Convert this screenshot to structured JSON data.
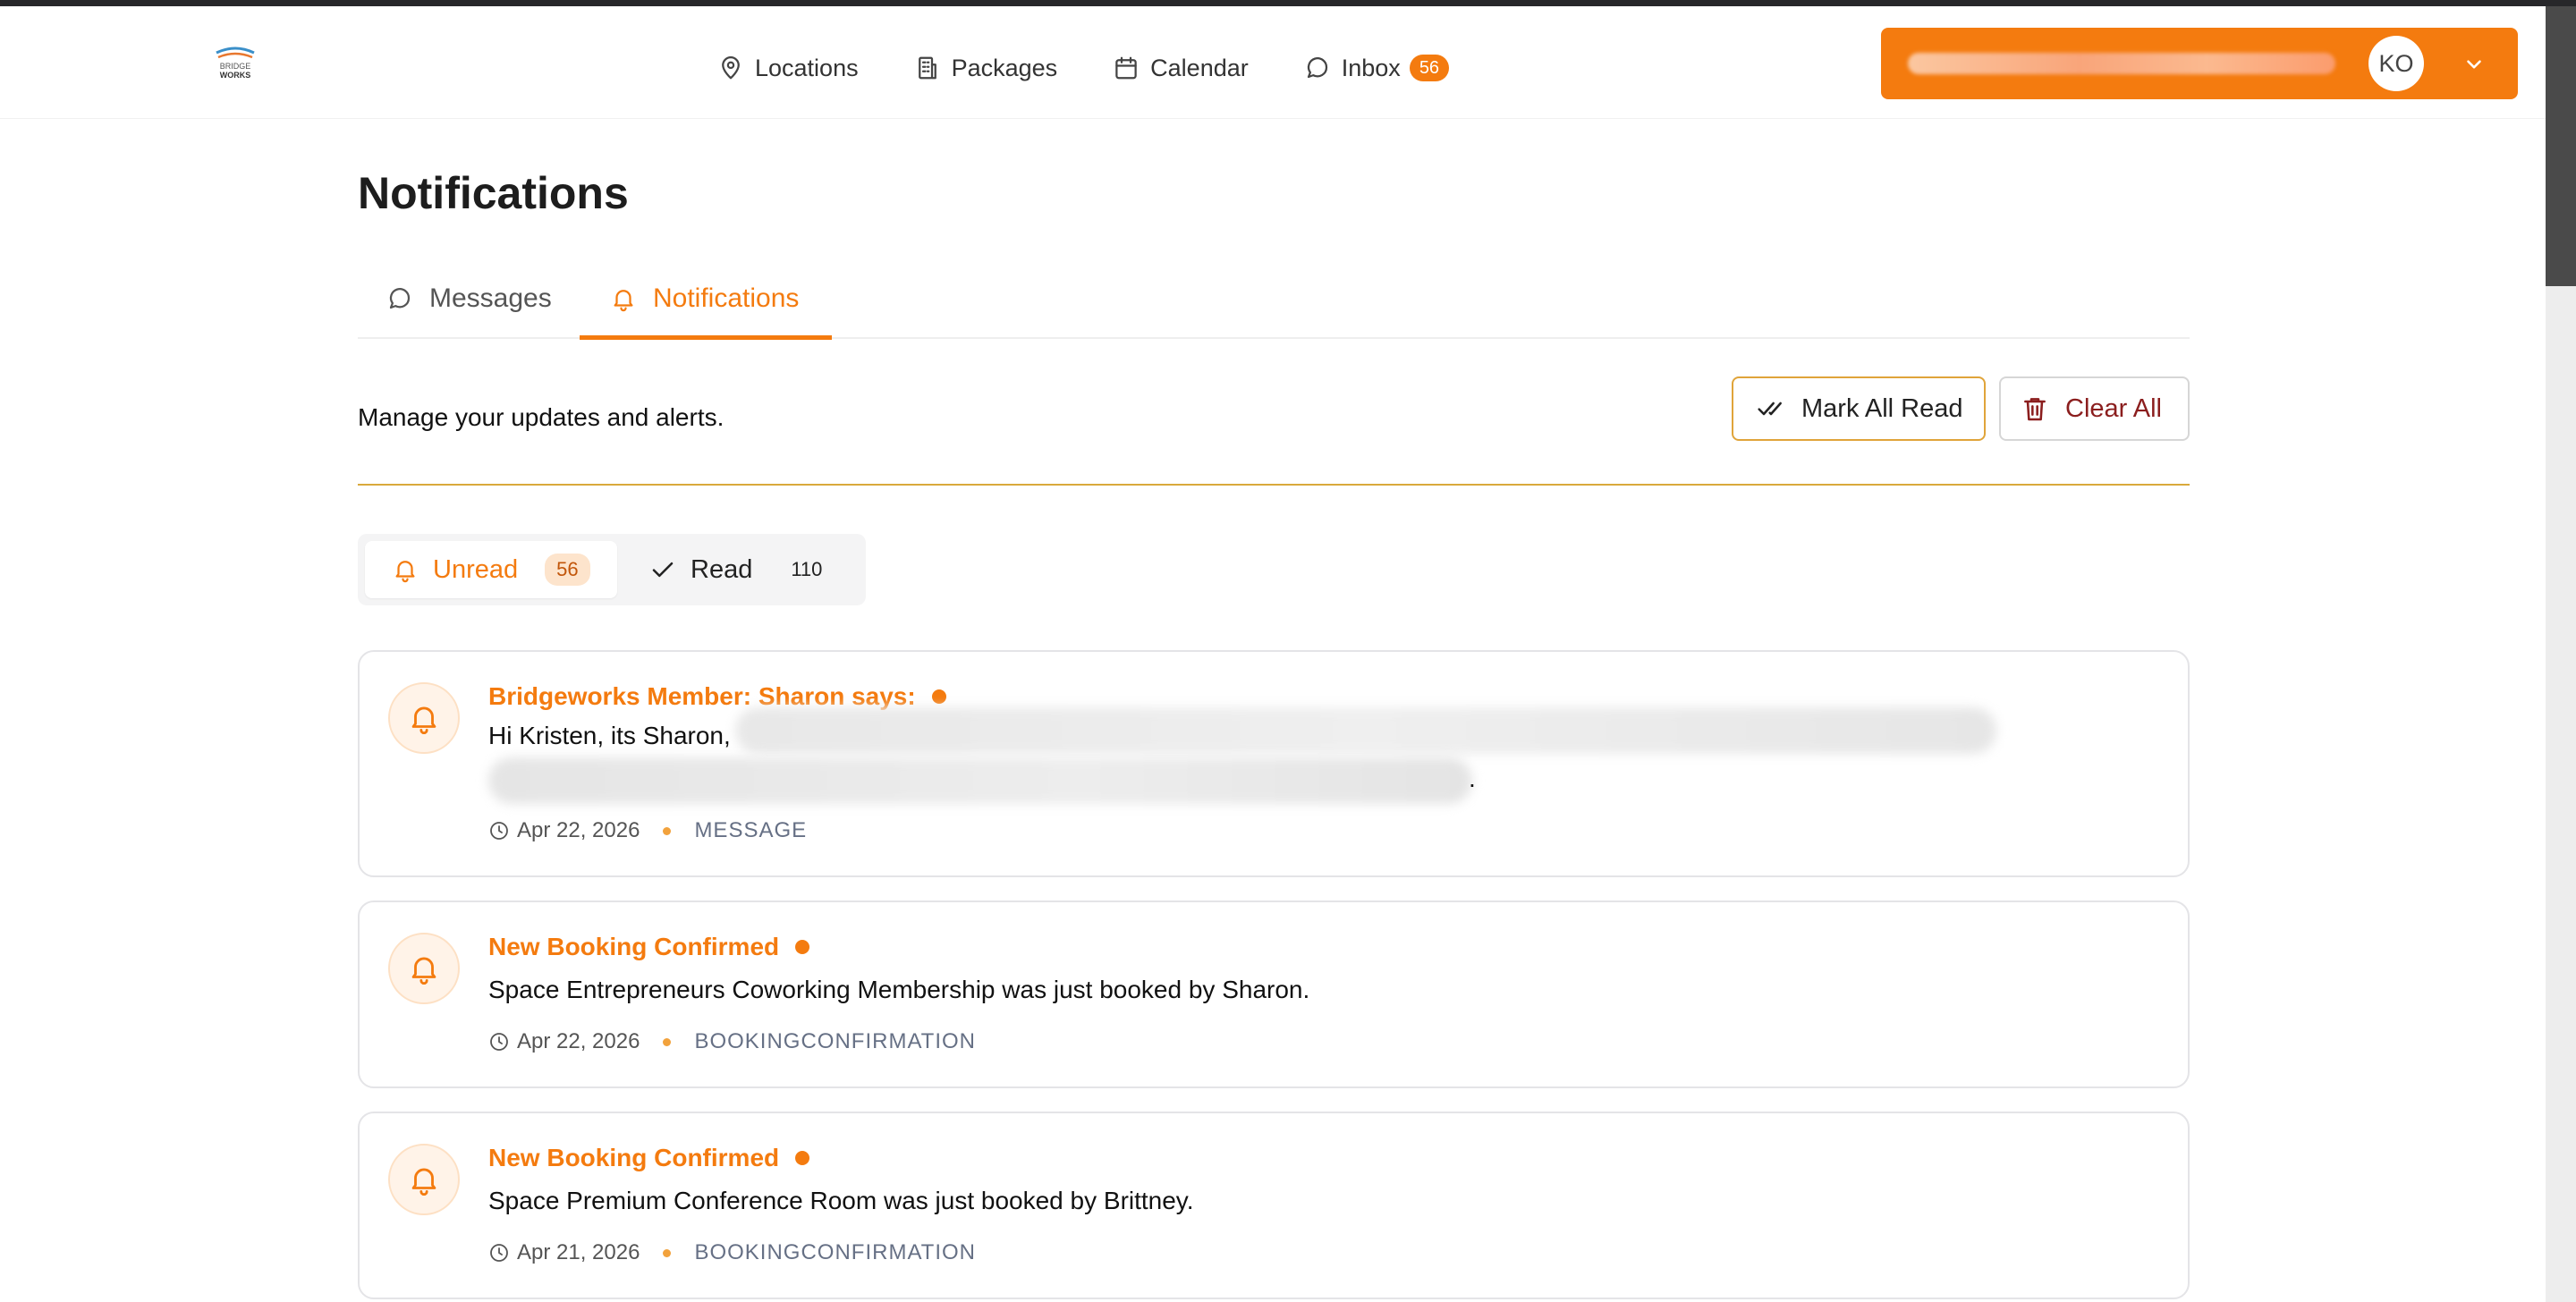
{
  "header": {
    "logo_text": "BRIDGE WORKS",
    "nav": [
      {
        "label": "Locations",
        "icon": "map-pin-icon"
      },
      {
        "label": "Packages",
        "icon": "building-icon"
      },
      {
        "label": "Calendar",
        "icon": "calendar-icon"
      },
      {
        "label": "Inbox",
        "icon": "message-circle-icon",
        "badge": "56"
      }
    ],
    "user": {
      "initials": "KO"
    }
  },
  "page": {
    "title": "Notifications",
    "tabs": [
      {
        "label": "Messages",
        "icon": "message-circle-icon"
      },
      {
        "label": "Notifications",
        "icon": "bell-icon",
        "active": true
      }
    ],
    "subtitle": "Manage your updates and alerts.",
    "actions": {
      "mark_all_read": "Mark All Read",
      "clear_all": "Clear All"
    },
    "filters": [
      {
        "label": "Unread",
        "count": "56",
        "active": true
      },
      {
        "label": "Read",
        "count": "110"
      }
    ]
  },
  "notifications": [
    {
      "title": "Bridgeworks Member: Sharon says:",
      "body": "Hi Kristen, its Sharon,",
      "body_end": ".",
      "date": "Apr 22, 2026",
      "type": "MESSAGE"
    },
    {
      "title": "New Booking Confirmed",
      "body": "Space Entrepreneurs Coworking Membership was just booked by Sharon.",
      "date": "Apr 22, 2026",
      "type": "BOOKINGCONFIRMATION"
    },
    {
      "title": "New Booking Confirmed",
      "body": "Space Premium Conference Room was just booked by Brittney.",
      "date": "Apr 21, 2026",
      "type": "BOOKINGCONFIRMATION"
    }
  ],
  "colors": {
    "accent": "#f47b0f",
    "divider": "#d9a93c",
    "danger": "#8b1e1e"
  }
}
